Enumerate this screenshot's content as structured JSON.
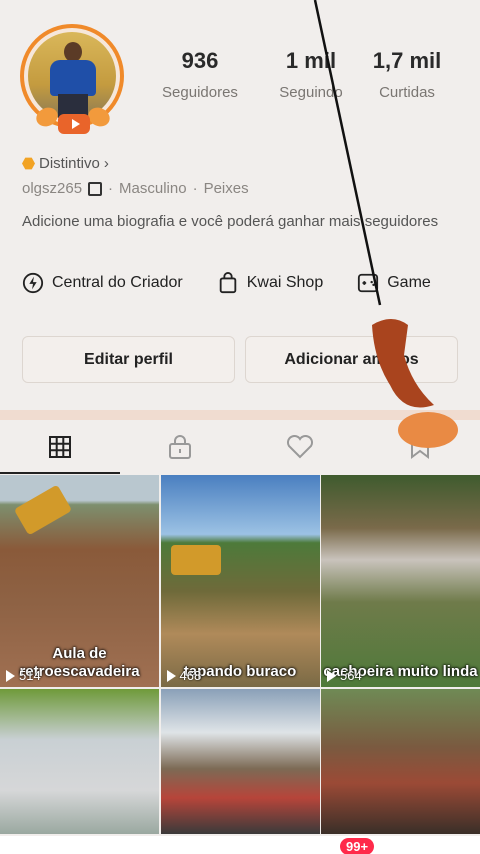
{
  "profile": {
    "stats": [
      {
        "value": "936",
        "label": "Seguidores"
      },
      {
        "value": "1 mil",
        "label": "Seguindo"
      },
      {
        "value": "1,7 mil",
        "label": "Curtidas"
      }
    ],
    "distintivo": "Distintivo",
    "username": "olgsz265",
    "gender": "Masculino",
    "sign": "Peixes",
    "bio": "Adicione uma biografia e você poderá ganhar mais seguidores"
  },
  "shortcuts": [
    {
      "label": "Central do Criador",
      "icon": "lightning-circle-icon"
    },
    {
      "label": "Kwai Shop",
      "icon": "shopping-bag-icon"
    },
    {
      "label": "Game",
      "icon": "gamepad-icon"
    }
  ],
  "buttons": {
    "edit": "Editar perfil",
    "add": "Adicionar amigos"
  },
  "tabs": [
    "grid-icon",
    "lock-icon",
    "heart-icon",
    "bookmark-icon"
  ],
  "videos": [
    {
      "title": "Aula de retroescavadeira",
      "views": "514"
    },
    {
      "title": "tapando buraco",
      "views": "468"
    },
    {
      "title": "cachoeira muito linda",
      "views": "564"
    },
    {
      "title": "",
      "views": ""
    },
    {
      "title": "",
      "views": ""
    },
    {
      "title": "",
      "views": ""
    }
  ],
  "nav": {
    "badge": "99+"
  },
  "colors": {
    "accent": "#f08a2a",
    "badge": "#ff2a4a"
  }
}
